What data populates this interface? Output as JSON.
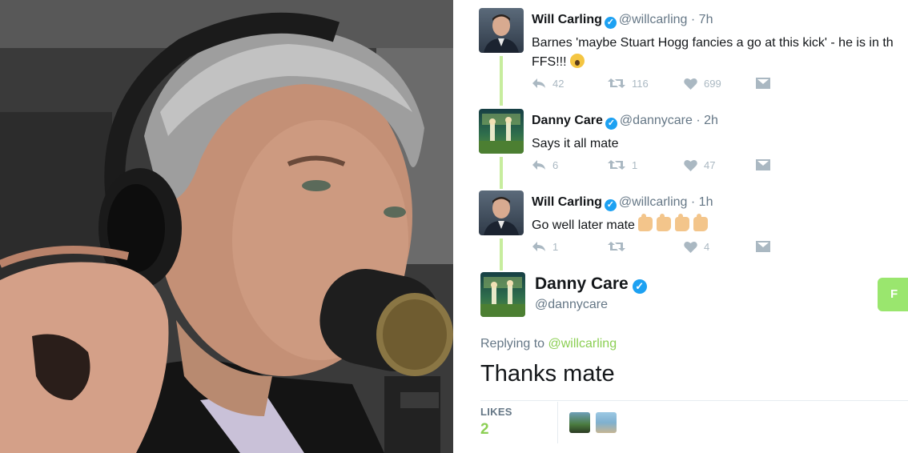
{
  "tweets": [
    {
      "name": "Will Carling",
      "handle": "@willcarling",
      "time": "· 7h",
      "text_line1": "Barnes 'maybe Stuart Hogg fancies a go at this kick' - he is in th",
      "text_line2": "FFS!!! ",
      "emoji": "face-screaming-icon",
      "replies": "42",
      "retweets": "116",
      "likes": "699"
    },
    {
      "name": "Danny Care",
      "handle": "@dannycare",
      "time": "· 2h",
      "text_line1": "Says it all mate",
      "replies": "6",
      "retweets": "1",
      "likes": "47"
    },
    {
      "name": "Will Carling",
      "handle": "@willcarling",
      "time": "· 1h",
      "text_line1": "Go well later mate ",
      "emoji": "thumbs-up-icon",
      "replies": "1",
      "retweets": "",
      "likes": "4"
    }
  ],
  "focused": {
    "name": "Danny Care",
    "handle": "@dannycare",
    "follow_label": "F",
    "replying_prefix": "Replying to ",
    "replying_to": "@willcarling",
    "text": "Thanks mate",
    "likes_label": "LIKES",
    "likes_count": "2"
  },
  "colors": {
    "accent_green": "#8ccf54",
    "thread_line": "#c7ed9e",
    "verified_blue": "#1da1f2",
    "muted": "#657786",
    "icon_gray": "#aab8c2"
  }
}
